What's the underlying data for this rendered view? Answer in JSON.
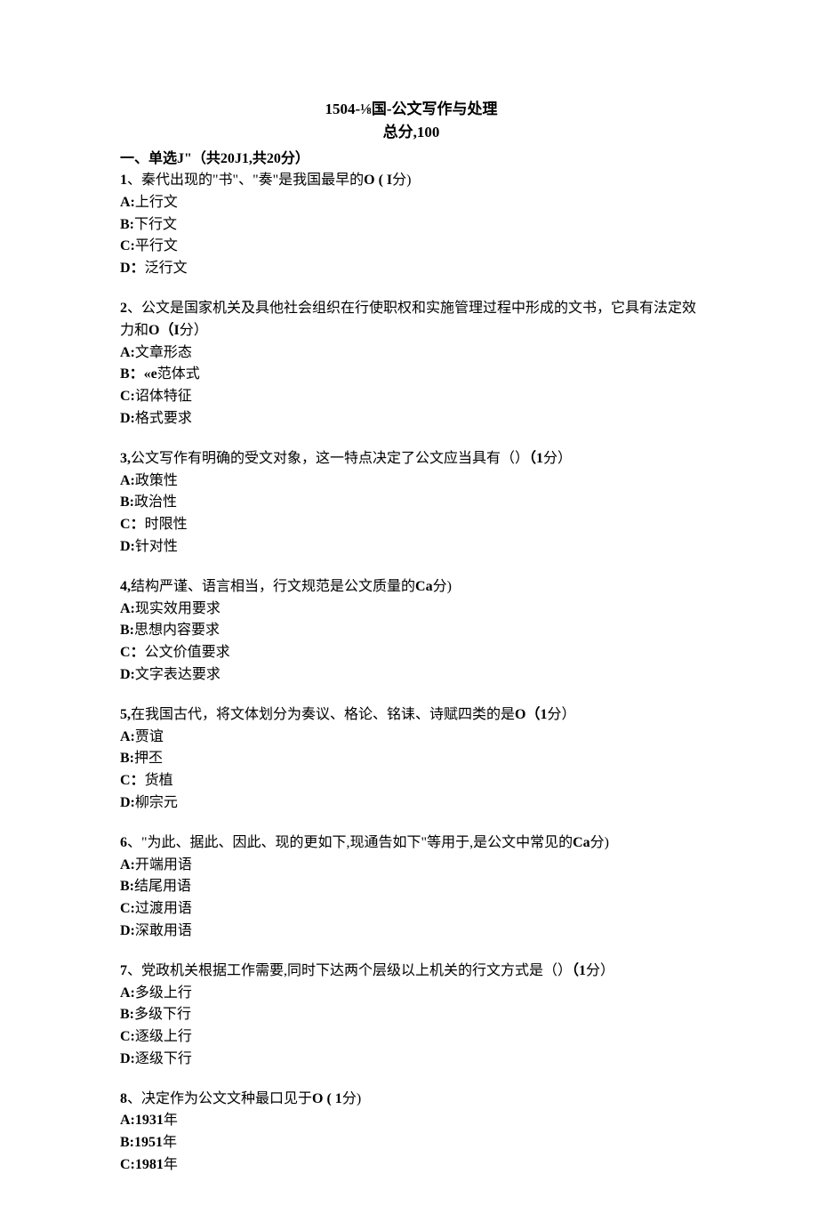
{
  "title": "1504-⅛国-公文写作与处理",
  "subtitle": "总分,100",
  "section_heading": "一、单选J\"（共20J1,共20分）",
  "questions": [
    {
      "num": "1",
      "sep": "、",
      "text_a": "秦代出现的\"书\"、\"奏\"是我国最早的",
      "bold_mid": "O ( I",
      "text_b": "分)",
      "options": [
        {
          "prefix": "A:",
          "text": "上行文"
        },
        {
          "prefix": "B:",
          "text": "下行文"
        },
        {
          "prefix": "C:",
          "text": "平行文"
        },
        {
          "prefix": "D：",
          "text": "泛行文"
        }
      ]
    },
    {
      "num": "2",
      "sep": "、",
      "text_a": "公文是国家机关及具他社会组织在行使职权和实施管理过程中形成的文书，它具有法定效力和",
      "bold_mid": "O（I",
      "text_b": "分）",
      "options": [
        {
          "prefix": "A:",
          "text": "文章形态"
        },
        {
          "prefix": "B：«e",
          "text": "范体式"
        },
        {
          "prefix": "C:",
          "text": "诏体特征"
        },
        {
          "prefix": "D:",
          "text": "格式要求"
        }
      ]
    },
    {
      "num": "3,",
      "sep": "",
      "text_a": "公文写作有明确的受文对象，这一特点决定了公文应当具有（）",
      "bold_mid": "（1",
      "text_b": "分）",
      "options": [
        {
          "prefix": "A:",
          "text": "政策性"
        },
        {
          "prefix": "B:",
          "text": "政治性"
        },
        {
          "prefix": "C：",
          "text": "时限性"
        },
        {
          "prefix": "D:",
          "text": "针对性"
        }
      ]
    },
    {
      "num": "4,",
      "sep": "",
      "text_a": "结构严谨、语言相当，行文规范是公文质量的",
      "bold_mid": "Ca",
      "text_b": "分)",
      "options": [
        {
          "prefix": "A:",
          "text": "现实效用要求"
        },
        {
          "prefix": "B:",
          "text": "思想内容要求"
        },
        {
          "prefix": "C：",
          "text": "公文价值要求"
        },
        {
          "prefix": "D:",
          "text": "文字表达要求"
        }
      ]
    },
    {
      "num": "5,",
      "sep": "",
      "text_a": "在我国古代，将文体划分为奏议、格论、铭诔、诗赋四类的是",
      "bold_mid": "O（1",
      "text_b": "分）",
      "options": [
        {
          "prefix": "A:",
          "text": "贾谊"
        },
        {
          "prefix": "B:",
          "text": "押丕"
        },
        {
          "prefix": "C：",
          "text": "货植"
        },
        {
          "prefix": "D:",
          "text": "柳宗元"
        }
      ]
    },
    {
      "num": "6",
      "sep": "、",
      "text_a": "\"为此、据此、因此、现的更如下,现通告如下\"等用于,是公文中常见的",
      "bold_mid": "Ca",
      "text_b": "分)",
      "options": [
        {
          "prefix": "A:",
          "text": "开端用语"
        },
        {
          "prefix": "B:",
          "text": "结尾用语"
        },
        {
          "prefix": "C:",
          "text": "过渡用语"
        },
        {
          "prefix": "D:",
          "text": "深敢用语"
        }
      ]
    },
    {
      "num": "7",
      "sep": "、",
      "text_a": "党政机关根据工作需要,同时下达两个层级以上机关的行文方式是（）",
      "bold_mid": "（1",
      "text_b": "分）",
      "options": [
        {
          "prefix": "A:",
          "text": "多级上行"
        },
        {
          "prefix": "B:",
          "text": "多级下行"
        },
        {
          "prefix": "C:",
          "text": "逐级上行"
        },
        {
          "prefix": "D:",
          "text": "逐级下行"
        }
      ]
    },
    {
      "num": "8",
      "sep": "、",
      "text_a": "决定作为公文文种最口见于",
      "bold_mid": "O ( 1",
      "text_b": "分)",
      "options": [
        {
          "prefix": "A:1931",
          "text": "年"
        },
        {
          "prefix": "B:1951",
          "text": "年"
        },
        {
          "prefix": "C:1981",
          "text": "年"
        }
      ]
    }
  ]
}
